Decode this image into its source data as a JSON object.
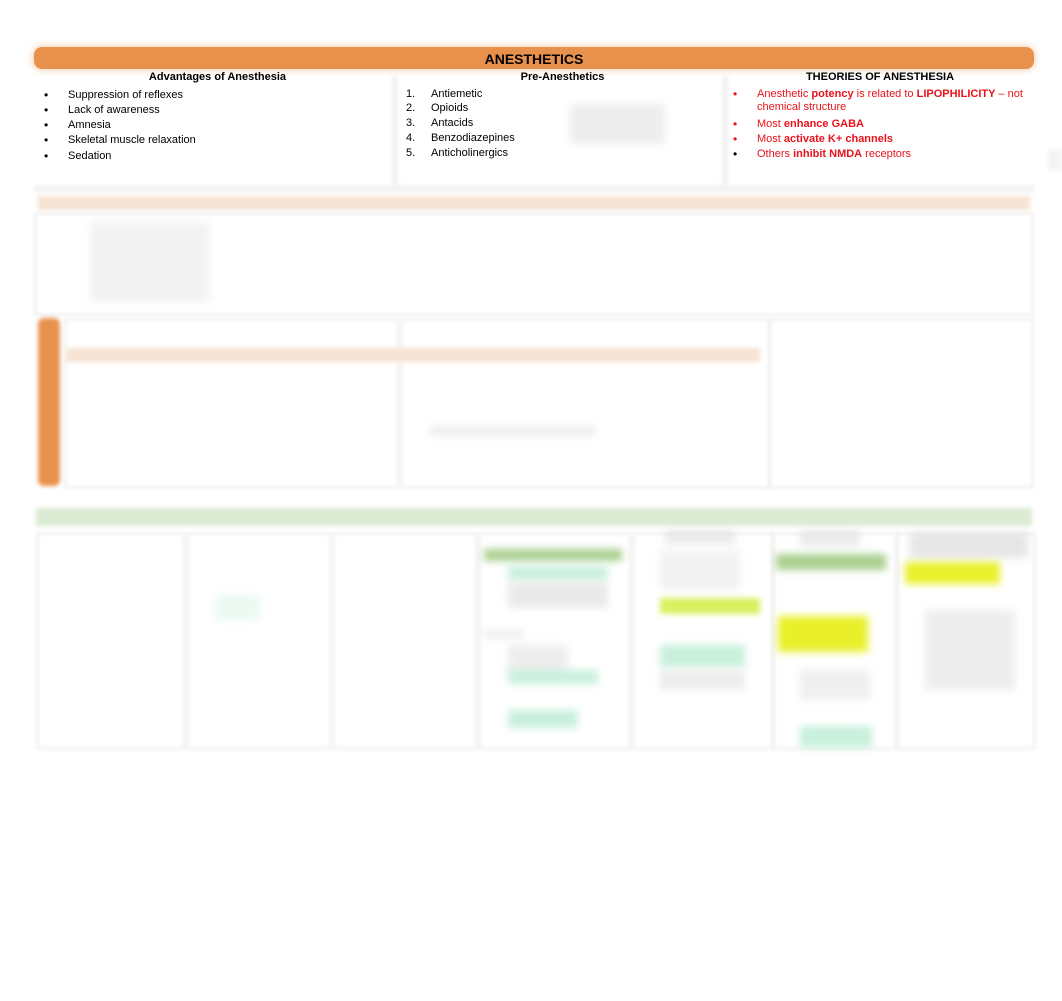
{
  "document": {
    "title": "ANESTHETICS",
    "columns": [
      {
        "heading": "Advantages of Anesthesia",
        "list_style": "bullet",
        "items": [
          {
            "text": "Suppression of reflexes"
          },
          {
            "text": "Lack of awareness"
          },
          {
            "text": "Amnesia"
          },
          {
            "text": "Skeletal muscle relaxation"
          },
          {
            "text": "Sedation"
          }
        ]
      },
      {
        "heading": "Pre-Anesthetics",
        "list_style": "numbered",
        "items": [
          {
            "num": "1.",
            "text": "Antiemetic"
          },
          {
            "num": "2.",
            "text": "Opioids"
          },
          {
            "num": "3.",
            "text": "Antacids"
          },
          {
            "num": "4.",
            "text": "Benzodiazepines"
          },
          {
            "num": "5.",
            "text": "Anticholinergics"
          }
        ]
      },
      {
        "heading": "THEORIES OF ANESTHESIA",
        "list_style": "bullet",
        "items": [
          {
            "parts": [
              "Anesthetic ",
              "potency",
              " is related to ",
              "LIPOPHILICITY",
              " – not chemical structure"
            ]
          },
          {
            "parts": [
              "Most ",
              "enhance GABA"
            ]
          },
          {
            "parts": [
              "Most ",
              "activate K+ channels"
            ]
          },
          {
            "parts": [
              "Others ",
              "inhibit NMDA",
              " receptors"
            ]
          }
        ]
      }
    ],
    "colors": {
      "title_bar": "#e8914d",
      "theory_text": "#e8131b",
      "section_peach": "#f7e3d3",
      "section_green": "#dcebd3",
      "highlight_yellow": "#e9f02a",
      "highlight_mint": "#c8f0dc"
    }
  }
}
